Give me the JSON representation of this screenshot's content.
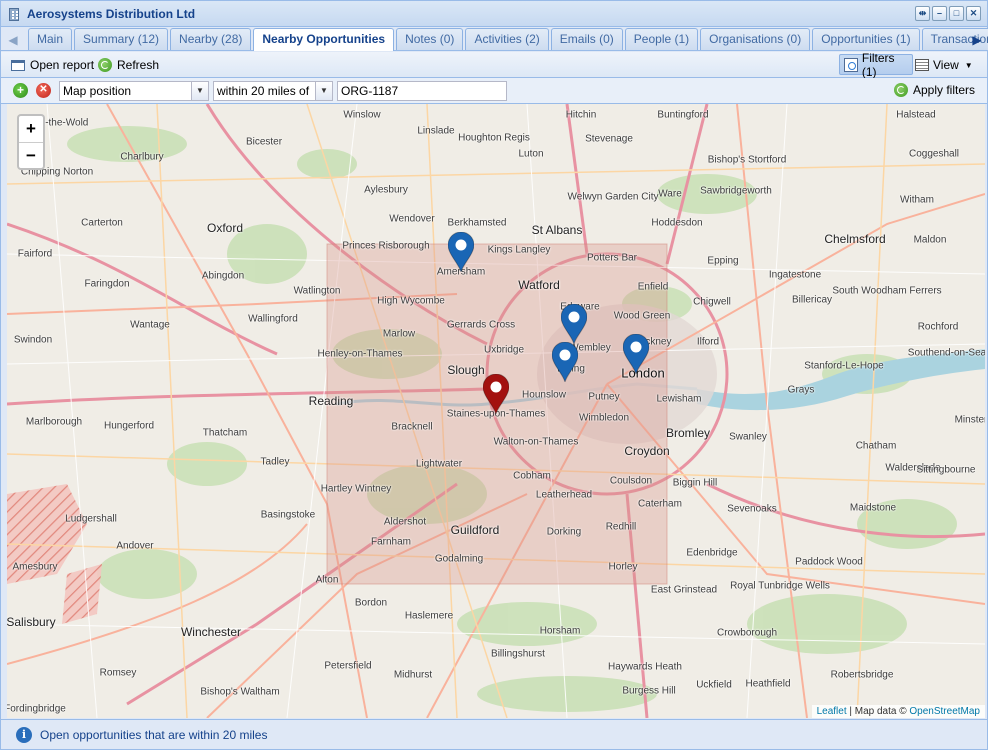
{
  "window": {
    "title": "Aerosystems Distribution Ltd"
  },
  "tabs": [
    {
      "label": "Main"
    },
    {
      "label": "Summary (12)"
    },
    {
      "label": "Nearby (28)"
    },
    {
      "label": "Nearby Opportunities"
    },
    {
      "label": "Notes (0)"
    },
    {
      "label": "Activities (2)"
    },
    {
      "label": "Emails (0)"
    },
    {
      "label": "People (1)"
    },
    {
      "label": "Organisations (0)"
    },
    {
      "label": "Opportunities (1)"
    },
    {
      "label": "Transactions ("
    }
  ],
  "active_tab": "Nearby Opportunities",
  "toolbar": {
    "open_report": "Open report",
    "refresh": "Refresh",
    "filters": "Filters (1)",
    "view": "View"
  },
  "filter": {
    "field": "Map position",
    "operator": "within 20 miles of",
    "value": "ORG-1187",
    "apply": "Apply filters"
  },
  "map": {
    "zoom_in": "+",
    "zoom_out": "−",
    "attribution_link": "Leaflet",
    "attribution_text": "| Map data ©",
    "attribution_osm": "OpenStreetMap",
    "colors": {
      "marker_blue": "#1a66b5",
      "marker_red": "#a3110f",
      "radius_area": "#d9928a"
    },
    "places": [
      {
        "name": "Aston-the-Wold"
      },
      {
        "name": "Winslow"
      },
      {
        "name": "Hitchin"
      },
      {
        "name": "Buntingford"
      },
      {
        "name": "Halstead"
      },
      {
        "name": "Linslade"
      },
      {
        "name": "Houghton Regis"
      },
      {
        "name": "Stevenage"
      },
      {
        "name": "Coggeshall"
      },
      {
        "name": "Bicester"
      },
      {
        "name": "Luton"
      },
      {
        "name": "Bishop's Stortford"
      },
      {
        "name": "Chipping Norton"
      },
      {
        "name": "Charlbury"
      },
      {
        "name": "Aylesbury"
      },
      {
        "name": "Welwyn Garden City"
      },
      {
        "name": "Ware"
      },
      {
        "name": "Sawbridgeworth"
      },
      {
        "name": "Witham"
      },
      {
        "name": "Carterton"
      },
      {
        "name": "Wendover"
      },
      {
        "name": "Berkhamsted"
      },
      {
        "name": "St Albans"
      },
      {
        "name": "Hoddesdon"
      },
      {
        "name": "Oxford"
      },
      {
        "name": "Princes Risborough"
      },
      {
        "name": "Chelmsford"
      },
      {
        "name": "Maldon"
      },
      {
        "name": "Fairford"
      },
      {
        "name": "Kings Langley"
      },
      {
        "name": "Potters Bar"
      },
      {
        "name": "Epping"
      },
      {
        "name": "Abingdon"
      },
      {
        "name": "Amersham"
      },
      {
        "name": "Faringdon"
      },
      {
        "name": "Watford"
      },
      {
        "name": "Enfield"
      },
      {
        "name": "Ingatestone"
      },
      {
        "name": "Watlington"
      },
      {
        "name": "South Woodham Ferrers"
      },
      {
        "name": "Chigwell"
      },
      {
        "name": "Billericay"
      },
      {
        "name": "High Wycombe"
      },
      {
        "name": "Wallingford"
      },
      {
        "name": "Wantage"
      },
      {
        "name": "Edgware"
      },
      {
        "name": "Wood Green"
      },
      {
        "name": "Gerrards Cross"
      },
      {
        "name": "Rochford"
      },
      {
        "name": "Swindon"
      },
      {
        "name": "Marlow"
      },
      {
        "name": "Wembley"
      },
      {
        "name": "Hackney"
      },
      {
        "name": "Ilford"
      },
      {
        "name": "Southend-on-Sea"
      },
      {
        "name": "Uxbridge"
      },
      {
        "name": "Henley-on-Thames"
      },
      {
        "name": "Ealing"
      },
      {
        "name": "Stanford-Le-Hope"
      },
      {
        "name": "London"
      },
      {
        "name": "Slough"
      },
      {
        "name": "Grays"
      },
      {
        "name": "Hounslow"
      },
      {
        "name": "Reading"
      },
      {
        "name": "Lewisham"
      },
      {
        "name": "Putney"
      },
      {
        "name": "Staines-upon-Thames"
      },
      {
        "name": "Marlborough"
      },
      {
        "name": "Hungerford"
      },
      {
        "name": "Wimbledon"
      },
      {
        "name": "Minster"
      },
      {
        "name": "Bracknell"
      },
      {
        "name": "Bromley"
      },
      {
        "name": "Swanley"
      },
      {
        "name": "Thatcham"
      },
      {
        "name": "Walton-on-Thames"
      },
      {
        "name": "Chatham"
      },
      {
        "name": "Croydon"
      },
      {
        "name": "Tadley"
      },
      {
        "name": "Lightwater"
      },
      {
        "name": "Walderslade"
      },
      {
        "name": "Sittingbourne"
      },
      {
        "name": "Cobham"
      },
      {
        "name": "Coulsdon"
      },
      {
        "name": "Biggin Hill"
      },
      {
        "name": "Hartley Wintney"
      },
      {
        "name": "Leatherhead"
      },
      {
        "name": "Basingstoke"
      },
      {
        "name": "Caterham"
      },
      {
        "name": "Maidstone"
      },
      {
        "name": "Ludgershall"
      },
      {
        "name": "Sevenoaks"
      },
      {
        "name": "Aldershot"
      },
      {
        "name": "Redhill"
      },
      {
        "name": "Guildford"
      },
      {
        "name": "Dorking"
      },
      {
        "name": "Andover"
      },
      {
        "name": "Farnham"
      },
      {
        "name": "Edenbridge"
      },
      {
        "name": "Godalming"
      },
      {
        "name": "Paddock Wood"
      },
      {
        "name": "Amesbury"
      },
      {
        "name": "Horley"
      },
      {
        "name": "Royal Tunbridge Wells"
      },
      {
        "name": "Alton"
      },
      {
        "name": "East Grinstead"
      },
      {
        "name": "Bordon"
      },
      {
        "name": "Salisbury"
      },
      {
        "name": "Haslemere"
      },
      {
        "name": "Winchester"
      },
      {
        "name": "Horsham"
      },
      {
        "name": "Crowborough"
      },
      {
        "name": "Billingshurst"
      },
      {
        "name": "Haywards Heath"
      },
      {
        "name": "Romsey"
      },
      {
        "name": "Petersfield"
      },
      {
        "name": "Midhurst"
      },
      {
        "name": "Robertsbridge"
      },
      {
        "name": "Bishop's Waltham"
      },
      {
        "name": "Burgess Hill"
      },
      {
        "name": "Uckfield"
      },
      {
        "name": "Heathfield"
      },
      {
        "name": "Fordingbridge"
      }
    ],
    "markers": [
      {
        "type": "opportunity",
        "color": "blue"
      },
      {
        "type": "opportunity",
        "color": "blue"
      },
      {
        "type": "opportunity",
        "color": "blue"
      },
      {
        "type": "opportunity",
        "color": "blue"
      },
      {
        "type": "organisation",
        "color": "red"
      }
    ]
  },
  "status": {
    "text": "Open opportunities that are within 20 miles"
  }
}
